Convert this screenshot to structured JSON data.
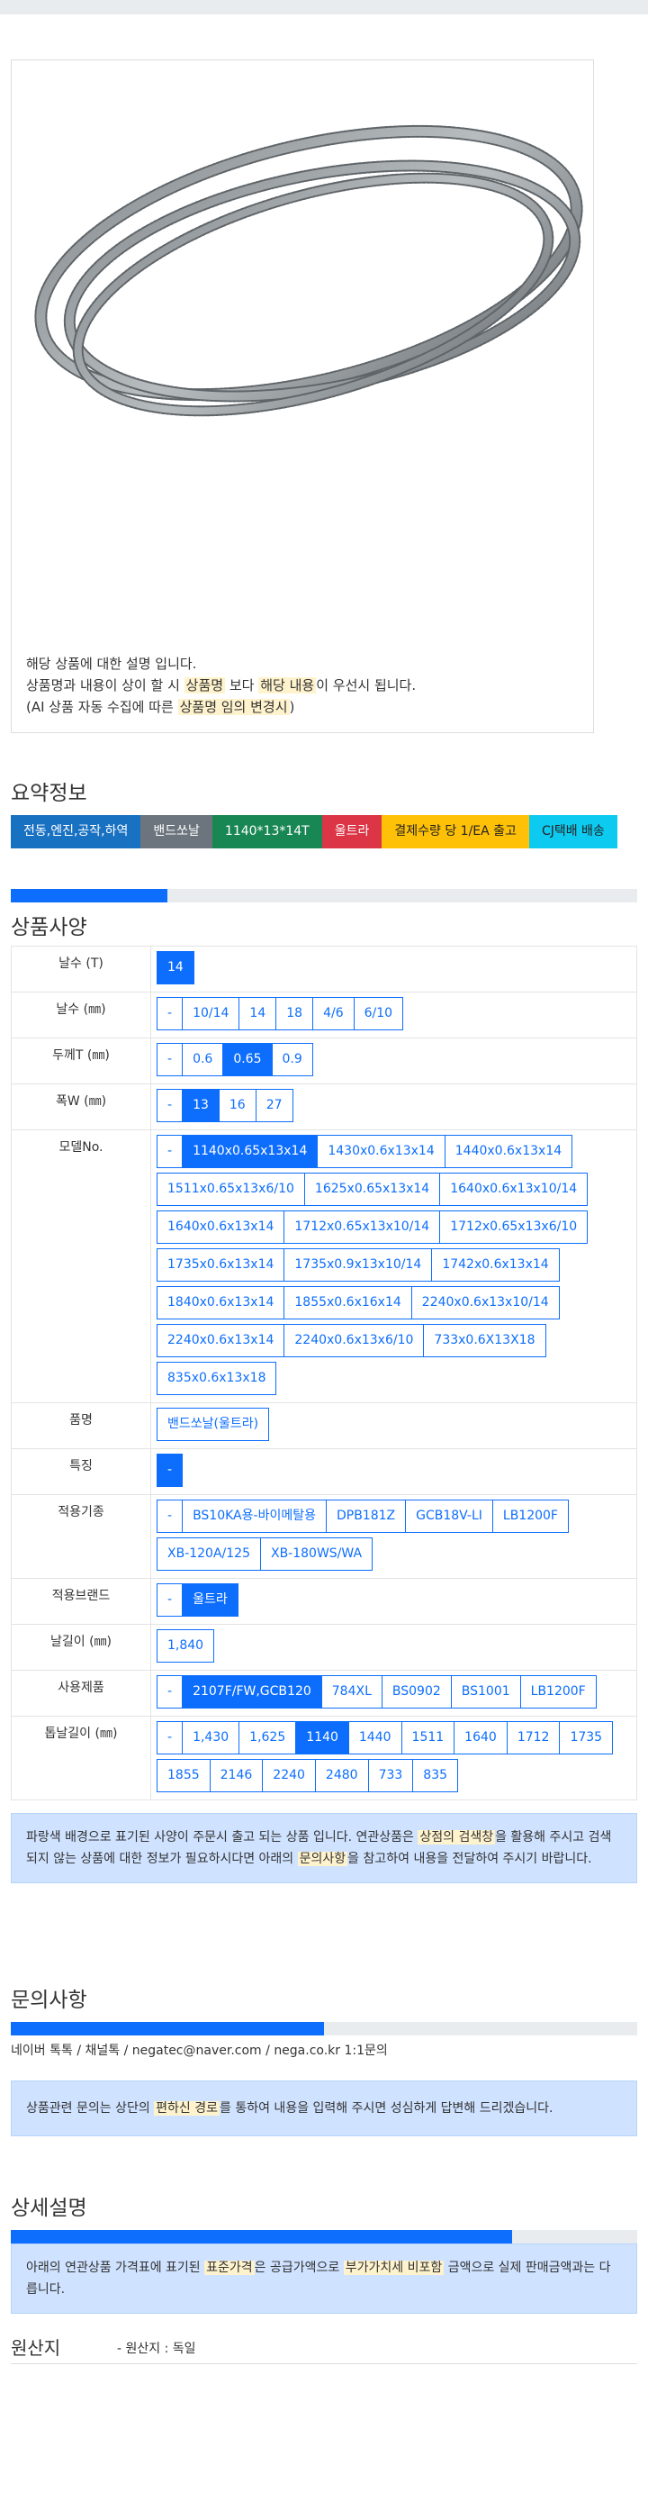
{
  "notice": {
    "line1": "해당 상품에 대한 설명 입니다.",
    "line2_a": "상품명과 내용이 상이 할 시",
    "line2_hl1": "상품명",
    "line2_b": "보다",
    "line2_hl2": "해당 내용",
    "line2_c": "이 우선시 됩니다.",
    "line3_a": "(AI 상품 자동 수집에 따른",
    "line3_hl": "상품명 임의 변경시",
    "line3_b": ")"
  },
  "summary": {
    "title": "요약정보",
    "tags": [
      "전동,엔진,공작,하역",
      "밴드쏘날",
      "1140*13*14T",
      "울트라",
      "결제수량 당 1/EA 출고",
      "CJ택배 배송"
    ]
  },
  "spec": {
    "title": "상품사양",
    "progress": 0.25,
    "rows": [
      {
        "label": "날수 (T)",
        "options": [
          "14"
        ],
        "selected": 0
      },
      {
        "label": "날수 (㎜)",
        "options": [
          "-",
          "10/14",
          "14",
          "18",
          "4/6",
          "6/10"
        ],
        "selected": -1
      },
      {
        "label": "두께T (㎜)",
        "options": [
          "-",
          "0.6",
          "0.65",
          "0.9"
        ],
        "selected": 2
      },
      {
        "label": "폭W (㎜)",
        "options": [
          "-",
          "13",
          "16",
          "27"
        ],
        "selected": 1
      },
      {
        "label": "모델No.",
        "options": [
          "-",
          "1140x0.65x13x14",
          "1430x0.6x13x14",
          "1440x0.6x13x14",
          "1511x0.65x13x6/10",
          "1625x0.65x13x14",
          "1640x0.6x13x10/14",
          "1640x0.6x13x14",
          "1712x0.65x13x10/14",
          "1712x0.65x13x6/10",
          "1735x0.6x13x14",
          "1735x0.9x13x10/14",
          "1742x0.6x13x14",
          "1840x0.6x13x14",
          "1855x0.6x16x14",
          "2240x0.6x13x10/14",
          "2240x0.6x13x14",
          "2240x0.6x13x6/10",
          "733x0.6X13X18",
          "835x0.6x13x18"
        ],
        "selected": 1
      },
      {
        "label": "품명",
        "options": [
          "밴드쏘날(울트라)"
        ],
        "selected": -1
      },
      {
        "label": "특징",
        "options": [
          "-"
        ],
        "selected": 0
      },
      {
        "label": "적용기종",
        "options": [
          "-",
          "BS10KA용-바이메탈용",
          "DPB181Z",
          "GCB18V-LI",
          "LB1200F",
          "XB-120A/125",
          "XB-180WS/WA"
        ],
        "selected": -1
      },
      {
        "label": "적용브랜드",
        "options": [
          "-",
          "울트라"
        ],
        "selected": 1
      },
      {
        "label": "날길이 (㎜)",
        "options": [
          "1,840"
        ],
        "selected": -1
      },
      {
        "label": "사용제품",
        "options": [
          "-",
          "2107F/FW,GCB120",
          "784XL",
          "BS0902",
          "BS1001",
          "LB1200F"
        ],
        "selected": 1
      },
      {
        "label": "톱날길이 (㎜)",
        "options": [
          "-",
          "1,430",
          "1,625",
          "1140",
          "1440",
          "1511",
          "1640",
          "1712",
          "1735",
          "1855",
          "2146",
          "2240",
          "2480",
          "733",
          "835"
        ],
        "selected": 3
      }
    ],
    "info_a": "파랑색 배경으로 표기된 사양이 주문시 출고 되는 상품 입니다. 연관상품은",
    "info_hl1": "상점의 검색창",
    "info_b": "을 활용해 주시고 검색되지 않는 상품에 대한 정보가 필요하시다면 아래의",
    "info_hl2": "문의사항",
    "info_c": "을 참고하여 내용을 전달하여 주시기 바랍니다."
  },
  "inquiry": {
    "title": "문의사항",
    "progress": 0.5,
    "contacts": [
      "네이버 톡톡",
      "채널톡",
      "negatec@naver.com",
      "nega.co.kr 1:1문의"
    ],
    "sep": "/",
    "info_a": "상품관련 문의는 상단의",
    "info_hl": "편하신 경로",
    "info_b": "를 통하여 내용을 입력해 주시면 성심하게 답변해 드리겠습니다."
  },
  "detail": {
    "title": "상세설명",
    "progress": 0.8,
    "info_a": "아래의 연관상품 가격표에 표기된",
    "info_hl1": "표준가격",
    "info_b": "은 공급가액으로",
    "info_hl2": "부가가치세 비포함",
    "info_c": "금액으로 실제 판매금액과는 다릅니다."
  },
  "origin": {
    "title": "원산지",
    "value": "- 원산지 : 독일"
  },
  "colors": {
    "primary": "#0d6efd",
    "info_bg": "#cfe2ff",
    "highlight": "#fff3cd"
  }
}
